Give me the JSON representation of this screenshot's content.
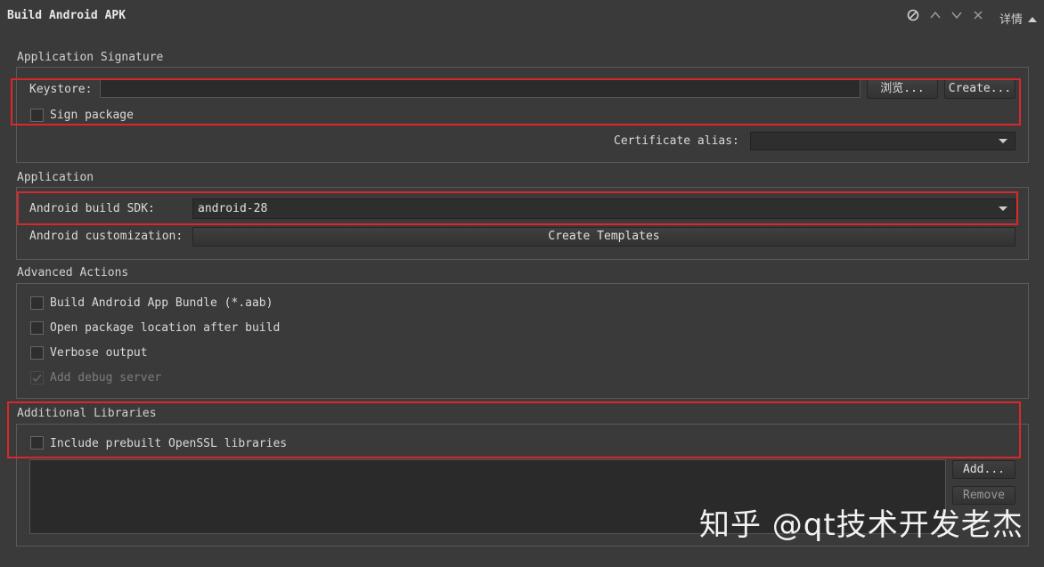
{
  "header": {
    "title": "Build Android APK",
    "details_label": "详情",
    "icons": [
      "disable-icon",
      "chevron-up-icon",
      "chevron-down-icon",
      "close-icon",
      "caret-up-icon"
    ]
  },
  "signature": {
    "group_title": "Application Signature",
    "keystore_label": "Keystore:",
    "keystore_value": "",
    "browse_label": "浏览...",
    "create_label": "Create...",
    "sign_package_label": "Sign package",
    "sign_package_checked": false,
    "cert_alias_label": "Certificate alias:",
    "cert_alias_value": ""
  },
  "application": {
    "group_title": "Application",
    "sdk_label": "Android build SDK:",
    "sdk_value": "android-28",
    "customization_label": "Android customization:",
    "create_templates_label": "Create Templates"
  },
  "advanced": {
    "group_title": "Advanced Actions",
    "options": [
      {
        "label": "Build Android App Bundle (*.aab)",
        "checked": false,
        "enabled": true
      },
      {
        "label": "Open package location after build",
        "checked": false,
        "enabled": true
      },
      {
        "label": "Verbose output",
        "checked": false,
        "enabled": true
      },
      {
        "label": "Add debug server",
        "checked": true,
        "enabled": false
      }
    ]
  },
  "libraries": {
    "group_title": "Additional Libraries",
    "openssl_label": "Include prebuilt OpenSSL libraries",
    "openssl_checked": false,
    "add_label": "Add...",
    "remove_label": "Remove",
    "items": []
  },
  "watermark": "知乎 @qt技术开发老杰",
  "colors": {
    "background": "#3a3a3a",
    "highlight": "#d8282b",
    "field": "#2b2b2b"
  }
}
